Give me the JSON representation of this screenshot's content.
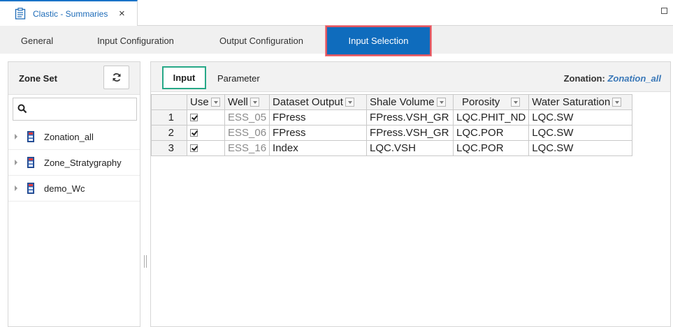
{
  "window": {
    "tab_title": "Clastic - Summaries",
    "tab_icon": "clipboard-icon",
    "close_glyph": "×"
  },
  "subtabs": [
    {
      "label": "General"
    },
    {
      "label": "Input Configuration"
    },
    {
      "label": "Output Configuration"
    },
    {
      "label": "Input Selection",
      "active": true
    }
  ],
  "zone_set": {
    "title": "Zone Set",
    "refresh_icon": "refresh-icon",
    "search_icon": "search-icon",
    "search_value": "",
    "items": [
      {
        "label": "Zonation_all"
      },
      {
        "label": "Zone_Stratygraphy"
      },
      {
        "label": "demo_Wc"
      }
    ]
  },
  "selection": {
    "tab_input": "Input",
    "tab_parameter": "Parameter",
    "zonation_label": "Zonation:",
    "zonation_value": "Zonation_all"
  },
  "table": {
    "headers": [
      "Use",
      "Well",
      "Dataset Output",
      "Shale Volume",
      "Porosity",
      "Water Saturation"
    ],
    "rows": [
      {
        "n": "1",
        "use": true,
        "well": "ESS_05",
        "dataset": "FPress",
        "shale": "FPress.VSH_GR",
        "porosity": "LQC.PHIT_ND",
        "water": "LQC.SW"
      },
      {
        "n": "2",
        "use": true,
        "well": "ESS_06",
        "dataset": "FPress",
        "shale": "FPress.VSH_GR",
        "porosity": "LQC.POR",
        "water": "LQC.SW"
      },
      {
        "n": "3",
        "use": true,
        "well": "ESS_16",
        "dataset": "Index",
        "shale": "LQC.VSH",
        "porosity": "LQC.POR",
        "water": "LQC.SW"
      }
    ]
  },
  "colors": {
    "accent_blue": "#0f6cbd",
    "active_tab_border": "#e05560",
    "input_tab_border": "#27a887",
    "zonation_value": "#3a78b8"
  }
}
